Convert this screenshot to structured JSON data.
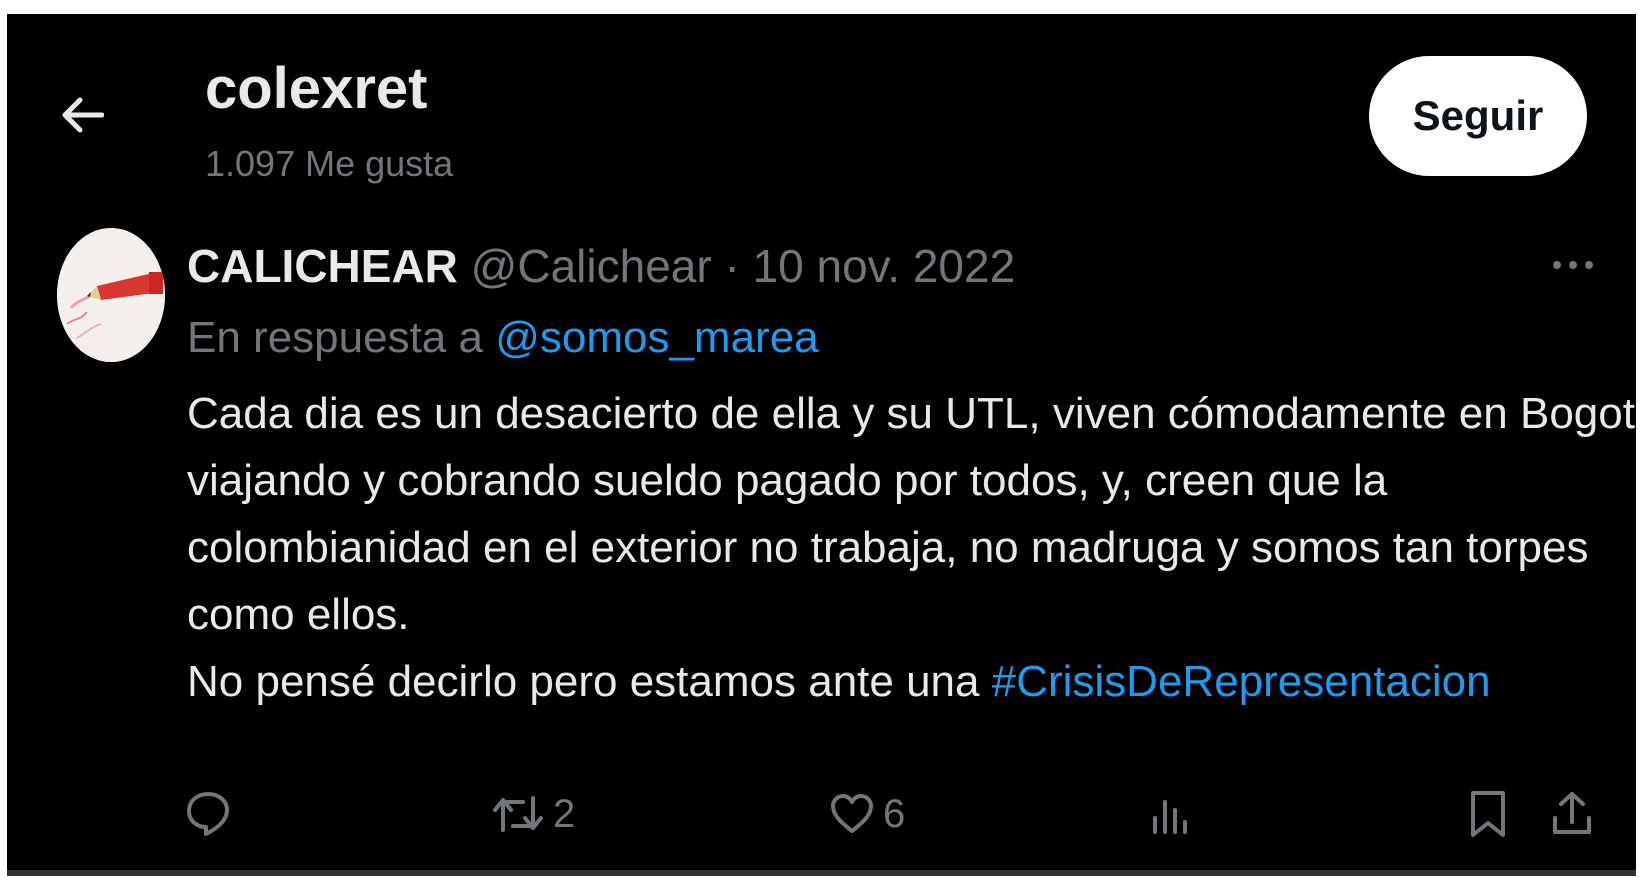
{
  "header": {
    "title": "colexret",
    "subtitle": "1.097 Me gusta",
    "follow_label": "Seguir",
    "back_icon": "arrow-left-icon"
  },
  "tweet": {
    "display_name": "CALICHEAR",
    "meta": "@Calichear · 10 nov. 2022",
    "reply_prefix": "En respuesta a",
    "reply_handle": "@somos_marea",
    "body_lines": [
      "Cada dia es un desacierto de ella y su UTL, viven cómodamente en Bogotá,",
      "viajando y cobrando sueldo pagado por todos, y, creen que la",
      "colombianidad en el exterior no trabaja, no madruga y somos tan torpes",
      "como ellos."
    ],
    "last_line_text": "No pensé decirlo pero estamos ante una",
    "hashtag": "#CrisisDeRepresentacion",
    "actions": {
      "reply_count": "",
      "retweet_count": "2",
      "like_count": "6",
      "views_count": ""
    }
  },
  "colors": {
    "background": "#000000",
    "text_primary": "#e7e9ea",
    "text_secondary": "#71767b",
    "link": "#1d9bf0",
    "button_bg": "#ffffff"
  }
}
